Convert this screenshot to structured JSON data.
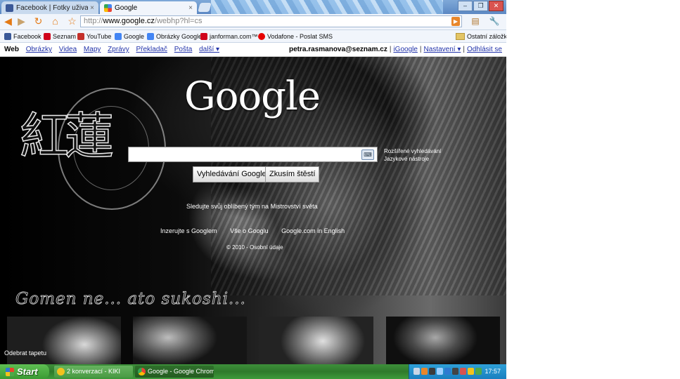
{
  "browser": {
    "tabs": [
      {
        "label": "Facebook | Fotky uživatele...",
        "close": "×"
      },
      {
        "label": "Google",
        "close": "×"
      }
    ],
    "url_prefix": "http://",
    "url_host": "www.google.cz",
    "url_path": "/webhp?hl=cs",
    "window_buttons": {
      "min": "–",
      "max": "❐",
      "close": "✕"
    }
  },
  "bookmarks": [
    {
      "label": "Facebook",
      "color": "#3b5998"
    },
    {
      "label": "Seznam",
      "color": "#d0021b"
    },
    {
      "label": "YouTube",
      "color": "#c4302b"
    },
    {
      "label": "Google",
      "color": "#4285f4"
    },
    {
      "label": "Obrázky Google",
      "color": "#4285f4"
    },
    {
      "label": "janforman.com™",
      "color": "#d0021b"
    },
    {
      "label": "Vodafone - Poslat SMS",
      "color": "#e60000"
    }
  ],
  "bookmarks_folder": "Ostatní záložky",
  "google_bar": {
    "links": [
      "Web",
      "Obrázky",
      "Videa",
      "Mapy",
      "Zprávy",
      "Překladač",
      "Pošta",
      "další ▾"
    ],
    "user": "petra.rasmanova@seznam.cz",
    "sep": "|",
    "account_links": [
      "iGoogle",
      "Nastavení ▾",
      "Odhlásit se"
    ]
  },
  "google_page": {
    "logo": "Google",
    "kanji": "紅蓮",
    "side_links": [
      "Rozšířené vyhledávání",
      "Jazykové nástroje"
    ],
    "buttons": {
      "search": "Vyhledávání Google",
      "lucky": "Zkusím štěstí"
    },
    "keyboard_icon": "⌨",
    "promo": "Sledujte svůj oblíbený tým na Mistrovství světa",
    "footer_links": [
      "Inzerujte s Googlem",
      "Vše o Googlu",
      "Google.com in English"
    ],
    "copyright": "© 2010 - Osobní údaje",
    "tagline": "Gomen ne... ato sukoshi...",
    "remove_wallpaper": "Odebrat tapetu"
  },
  "taskbar": {
    "start": "Start",
    "tasks": [
      "2 konverzací - KIKI",
      "Google - Google Chrome"
    ],
    "clock": "17:57"
  },
  "colors": {
    "link_blue": "#2233aa",
    "chrome_accent": "#e47a15",
    "xp_green": "#3e9b3b",
    "tray_blue": "#1a7fbf"
  }
}
